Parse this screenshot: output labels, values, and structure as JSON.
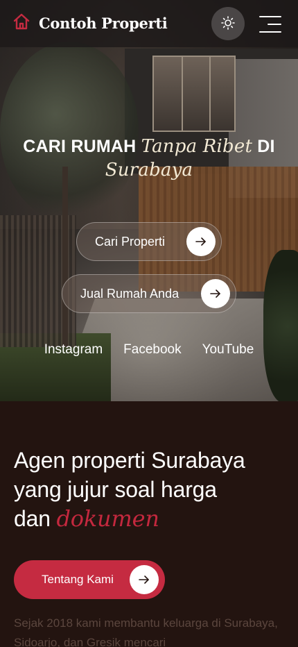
{
  "nav": {
    "brand_title": "Contoh Properti",
    "brand_icon": "home-icon",
    "theme_icon": "sun-icon",
    "menu_icon": "hamburger-menu-icon"
  },
  "hero": {
    "title_part1": "CARI RUMAH",
    "title_italic1": "Tanpa Ribet",
    "title_part2": "DI",
    "title_italic2": "Surabaya",
    "buttons": [
      {
        "label": "Cari Properti",
        "icon": "arrow-right-icon"
      },
      {
        "label": "Jual Rumah Anda",
        "icon": "arrow-right-icon"
      }
    ],
    "socials": [
      "Instagram",
      "Facebook",
      "YouTube"
    ]
  },
  "about": {
    "title_line1": "Agen properti Surabaya",
    "title_line2": "yang jujur soal harga",
    "title_line3_plain": "dan",
    "title_line3_italic": "dokumen",
    "cta_label": "Tentang Kami",
    "description": "Sejak 2018 kami membantu keluarga di Surabaya, Sidoarjo, dan Gresik mencari"
  },
  "colors": {
    "accent": "#c52b41",
    "dark_bg": "#231410",
    "navbar_bg": "#1c1818"
  }
}
